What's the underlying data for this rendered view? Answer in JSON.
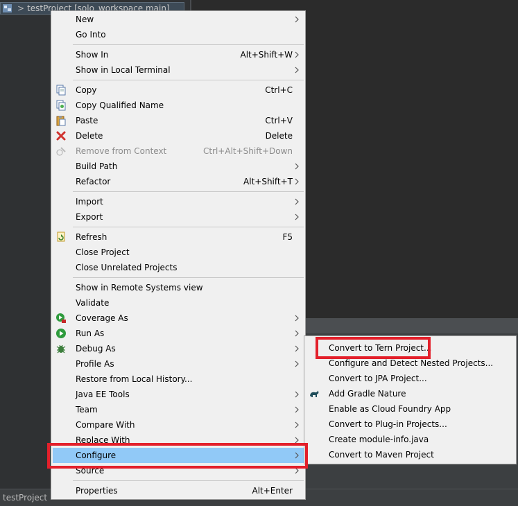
{
  "tree": {
    "project_label": "testProject [solo_workspace main]",
    "chevron": ">"
  },
  "status_bar": {
    "text": "testProject"
  },
  "context_menu": {
    "items": [
      {
        "label": "New",
        "accel": "",
        "submenu": true,
        "icon": ""
      },
      {
        "label": "Go Into",
        "accel": "",
        "submenu": false,
        "icon": ""
      },
      {
        "label": "Show In",
        "accel": "Alt+Shift+W",
        "submenu": true,
        "icon": ""
      },
      {
        "label": "Show in Local Terminal",
        "accel": "",
        "submenu": true,
        "icon": ""
      },
      {
        "label": "Copy",
        "accel": "Ctrl+C",
        "submenu": false,
        "icon": "copy-icon"
      },
      {
        "label": "Copy Qualified Name",
        "accel": "",
        "submenu": false,
        "icon": "copy-qualified-icon"
      },
      {
        "label": "Paste",
        "accel": "Ctrl+V",
        "submenu": false,
        "icon": "paste-icon"
      },
      {
        "label": "Delete",
        "accel": "Delete",
        "submenu": false,
        "icon": "delete-icon"
      },
      {
        "label": "Remove from Context",
        "accel": "Ctrl+Alt+Shift+Down",
        "submenu": false,
        "icon": "remove-context-icon",
        "disabled": true
      },
      {
        "label": "Build Path",
        "accel": "",
        "submenu": true,
        "icon": ""
      },
      {
        "label": "Refactor",
        "accel": "Alt+Shift+T",
        "submenu": true,
        "icon": ""
      },
      {
        "label": "Import",
        "accel": "",
        "submenu": true,
        "icon": ""
      },
      {
        "label": "Export",
        "accel": "",
        "submenu": true,
        "icon": ""
      },
      {
        "label": "Refresh",
        "accel": "F5",
        "submenu": false,
        "icon": "refresh-icon"
      },
      {
        "label": "Close Project",
        "accel": "",
        "submenu": false,
        "icon": ""
      },
      {
        "label": "Close Unrelated Projects",
        "accel": "",
        "submenu": false,
        "icon": ""
      },
      {
        "label": "Show in Remote Systems view",
        "accel": "",
        "submenu": false,
        "icon": ""
      },
      {
        "label": "Validate",
        "accel": "",
        "submenu": false,
        "icon": ""
      },
      {
        "label": "Coverage As",
        "accel": "",
        "submenu": true,
        "icon": "coverage-icon"
      },
      {
        "label": "Run As",
        "accel": "",
        "submenu": true,
        "icon": "run-icon"
      },
      {
        "label": "Debug As",
        "accel": "",
        "submenu": true,
        "icon": "debug-icon"
      },
      {
        "label": "Profile As",
        "accel": "",
        "submenu": true,
        "icon": ""
      },
      {
        "label": "Restore from Local History...",
        "accel": "",
        "submenu": false,
        "icon": ""
      },
      {
        "label": "Java EE Tools",
        "accel": "",
        "submenu": true,
        "icon": ""
      },
      {
        "label": "Team",
        "accel": "",
        "submenu": true,
        "icon": ""
      },
      {
        "label": "Compare With",
        "accel": "",
        "submenu": true,
        "icon": ""
      },
      {
        "label": "Replace With",
        "accel": "",
        "submenu": true,
        "icon": ""
      },
      {
        "label": "Configure",
        "accel": "",
        "submenu": true,
        "icon": "",
        "selected": true
      },
      {
        "label": "Source",
        "accel": "",
        "submenu": true,
        "icon": ""
      },
      {
        "label": "Properties",
        "accel": "Alt+Enter",
        "submenu": false,
        "icon": ""
      }
    ]
  },
  "submenu": {
    "items": [
      {
        "label": "Convert to Tern Project...",
        "icon": ""
      },
      {
        "label": "Configure and Detect Nested Projects...",
        "icon": ""
      },
      {
        "label": "Convert to JPA Project...",
        "icon": ""
      },
      {
        "label": "Add Gradle Nature",
        "icon": "gradle-icon"
      },
      {
        "label": "Enable as Cloud Foundry App",
        "icon": ""
      },
      {
        "label": "Convert to Plug-in Projects...",
        "icon": ""
      },
      {
        "label": "Create module-info.java",
        "icon": ""
      },
      {
        "label": "Convert to Maven Project",
        "icon": ""
      }
    ]
  },
  "colors": {
    "selection": "#91c9f7",
    "annotation_red": "#e3202b"
  }
}
